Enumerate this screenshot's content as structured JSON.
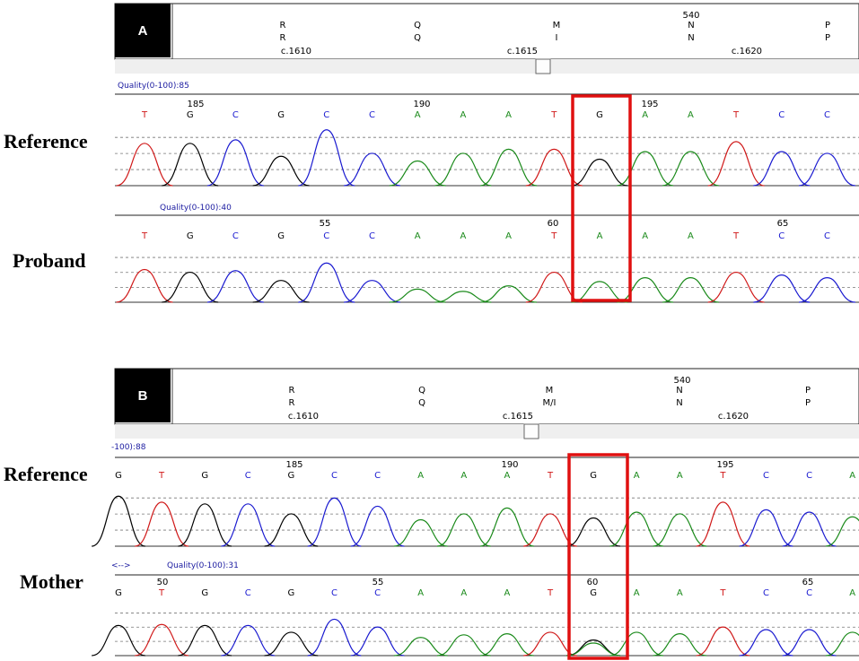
{
  "colors": {
    "A": "#1a8a1a",
    "C": "#1a1ad0",
    "G": "#000000",
    "T": "#d01818",
    "highlight": "#e01010"
  },
  "panels": [
    {
      "letter": "A",
      "annotation": {
        "aa_top": [
          "R",
          "Q",
          "M",
          "N",
          "P"
        ],
        "aa_bottom": [
          "R",
          "Q",
          "I",
          "N",
          "P"
        ],
        "codon_number": "540",
        "cdna": [
          "c.1610",
          "c.1615",
          "c.1620"
        ]
      },
      "tracks": [
        {
          "side_label": "Reference",
          "quality": "Quality(0-100):85",
          "position_numbers": [
            "185",
            "190",
            "195"
          ],
          "bases": [
            "T",
            "G",
            "C",
            "G",
            "C",
            "C",
            "A",
            "A",
            "A",
            "T",
            "G",
            "A",
            "A",
            "T",
            "C",
            "C"
          ]
        },
        {
          "side_label": "Proband",
          "quality": "Quality(0-100):40",
          "position_numbers": [
            "55",
            "60",
            "65"
          ],
          "bases": [
            "T",
            "G",
            "C",
            "G",
            "C",
            "C",
            "A",
            "A",
            "A",
            "T",
            "A",
            "A",
            "A",
            "T",
            "C",
            "C"
          ]
        }
      ]
    },
    {
      "letter": "B",
      "annotation": {
        "aa_top": [
          "R",
          "Q",
          "M",
          "N",
          "P"
        ],
        "aa_bottom": [
          "R",
          "Q",
          "M/I",
          "N",
          "P"
        ],
        "codon_number": "540",
        "cdna": [
          "c.1610",
          "c.1615",
          "c.1620"
        ]
      },
      "tracks": [
        {
          "side_label": "Reference",
          "quality": "-100):88",
          "position_numbers": [
            "185",
            "190",
            "195"
          ],
          "bases": [
            "G",
            "T",
            "G",
            "C",
            "G",
            "C",
            "C",
            "A",
            "A",
            "A",
            "T",
            "G",
            "A",
            "A",
            "T",
            "C",
            "C",
            "A"
          ]
        },
        {
          "side_label": "Mother",
          "quality_prefix": "<-->",
          "quality": "Quality(0-100):31",
          "position_numbers": [
            "50",
            "55",
            "60",
            "65"
          ],
          "bases": [
            "G",
            "T",
            "G",
            "C",
            "G",
            "C",
            "C",
            "A",
            "A",
            "A",
            "T",
            "G",
            "A",
            "A",
            "T",
            "C",
            "C",
            "A"
          ]
        }
      ]
    }
  ]
}
